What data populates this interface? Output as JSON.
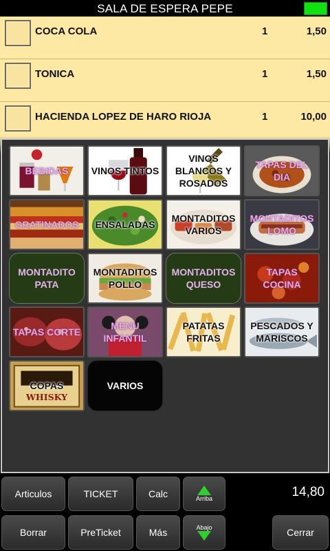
{
  "header": {
    "title": "SALA DE ESPERA  PEPE",
    "status_color": "#11e011"
  },
  "order": {
    "lines": [
      {
        "name": "COCA COLA",
        "qty": "1",
        "price": "1,50"
      },
      {
        "name": "TONICA",
        "qty": "1",
        "price": "1,50"
      },
      {
        "name": "HACIENDA LOPEZ DE HARO RIOJA",
        "qty": "1",
        "price": "10,00"
      }
    ]
  },
  "categories": [
    {
      "label": "BEBIDAS",
      "icon": "drinks-photo"
    },
    {
      "label": "VINOS TINTOS",
      "icon": "red-wine-photo"
    },
    {
      "label": "VINOS BLANCOS Y ROSADOS",
      "icon": "white-wine-photo"
    },
    {
      "label": "TAPAS DEL DIA",
      "icon": "tapas-dish-photo"
    },
    {
      "label": "GRATINADOS",
      "icon": "lasagna-photo"
    },
    {
      "label": "ENSALADAS",
      "icon": "salad-photo"
    },
    {
      "label": "MONTADITOS VARIOS",
      "icon": "sandwiches-photo"
    },
    {
      "label": "MONTADITOS LOMO",
      "icon": "loin-sandwich-photo"
    },
    {
      "label": "MONTADITO PATA",
      "icon": ""
    },
    {
      "label": "MONTADITOS POLLO",
      "icon": "chicken-sandwich-photo"
    },
    {
      "label": "MONTADITOS QUESO",
      "icon": ""
    },
    {
      "label": "TAPAS COCINA",
      "icon": "stew-photo"
    },
    {
      "label": "TAPAS CORTE",
      "icon": "cured-meat-photo"
    },
    {
      "label": "MENU INFANTIL",
      "icon": "kids-menu-photo"
    },
    {
      "label": "PATATAS FRITAS",
      "icon": "fries-photo"
    },
    {
      "label": "PESCADOS Y MARISCOS",
      "icon": "fish-photo"
    },
    {
      "label": "COPAS",
      "icon": "whisky-label-photo"
    },
    {
      "label": "VARIOS",
      "icon": ""
    }
  ],
  "footer": {
    "articulos": "Articulos",
    "ticket": "TICKET",
    "calc": "Calc",
    "arriba": "Arriba",
    "total": "14,80",
    "borrar": "Borrar",
    "preticket": "PreTicket",
    "mas": "Más",
    "abajo": "Abajo",
    "cerrar": "Cerrar"
  }
}
